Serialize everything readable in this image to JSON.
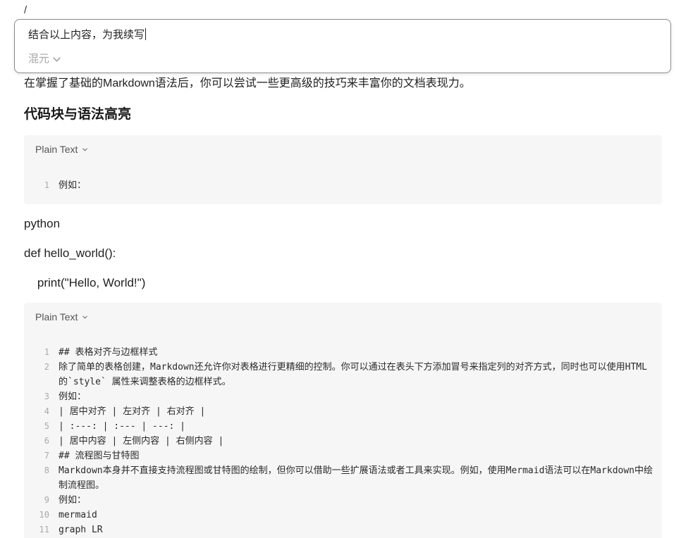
{
  "slash": "/",
  "ai_prompt": {
    "input_value": "结合以上内容，为我续写",
    "model_label": "混元"
  },
  "doc": {
    "intro": "在掌握了基础的Markdown语法后，你可以尝试一些更高级的技巧来丰富你的文档表现力。",
    "heading": "代码块与语法高亮",
    "code_block_1": {
      "language": "Plain Text",
      "lines": [
        {
          "num": "1",
          "text": "例如："
        }
      ]
    },
    "para_python": "python",
    "para_def": "def hello_world():",
    "para_print": "    print(\"Hello, World!\")",
    "code_block_2": {
      "language": "Plain Text",
      "lines": [
        {
          "num": "1",
          "text": "## 表格对齐与边框样式"
        },
        {
          "num": "2",
          "text": "除了简单的表格创建，Markdown还允许你对表格进行更精细的控制。你可以通过在表头下方添加冒号来指定列的对齐方式，同时也可以使用HTML的`style` 属性来调整表格的边框样式。"
        },
        {
          "num": "3",
          "text": "例如："
        },
        {
          "num": "4",
          "text": "| 居中对齐 | 左对齐 | 右对齐 |"
        },
        {
          "num": "5",
          "text": "| :---: | :--- | ---: |"
        },
        {
          "num": "6",
          "text": "| 居中内容 | 左侧内容 | 右侧内容 |"
        },
        {
          "num": "7",
          "text": "## 流程图与甘特图"
        },
        {
          "num": "8",
          "text": "Markdown本身并不直接支持流程图或甘特图的绘制，但你可以借助一些扩展语法或者工具来实现。例如，使用Mermaid语法可以在Markdown中绘制流程图。"
        },
        {
          "num": "9",
          "text": "例如："
        },
        {
          "num": "10",
          "text": "mermaid"
        },
        {
          "num": "11",
          "text": "graph LR"
        }
      ]
    }
  }
}
